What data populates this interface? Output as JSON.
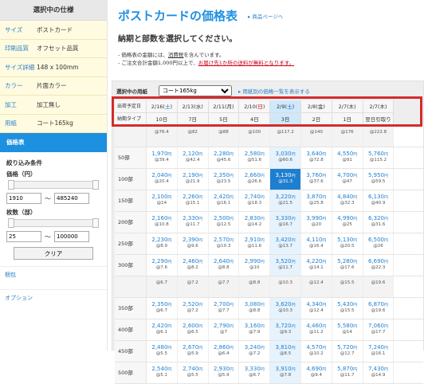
{
  "sidebar": {
    "title": "選択中の仕様",
    "specs": [
      {
        "k": "サイズ",
        "v": "ポストカード"
      },
      {
        "k": "印刷品質",
        "v": "オフセット品質"
      },
      {
        "k": "サイズ詳細",
        "v": "148 x 100mm"
      },
      {
        "k": "カラー",
        "v": "片面カラー"
      },
      {
        "k": "加工",
        "v": "加工無し"
      },
      {
        "k": "用紙",
        "v": "コート165kg"
      }
    ],
    "price_tab": "価格表",
    "filter_title": "絞り込み条件",
    "price_label": "価格（円）",
    "price_min": "1910",
    "price_max": "485240",
    "qty_label": "枚数（部）",
    "qty_min": "25",
    "qty_max": "100000",
    "range_sep": "〜",
    "clear": "クリア",
    "link1": "梱包",
    "link2": "オプション"
  },
  "main": {
    "title": "ポストカードの価格表",
    "title_link": "▸ 商品ページへ",
    "subtitle": "納期と部数を選択してください。",
    "note1_a": "- 価格表の金額には、",
    "note1_b": "消費税",
    "note1_c": "を含んでいます。",
    "note2_a": "- ご注文合計金額1,000円以上で、",
    "note2_b": "お届け先1か所の送料が無料となります。",
    "paper_label": "選択中の用紙",
    "paper_value": "コート165kg",
    "paper_link": "▸ 用紙別の価格一覧を表示する",
    "ship_label": "出荷予定日",
    "type_label": "納期タイプ"
  },
  "dates": [
    {
      "d": "2/16",
      "w": "土",
      "cls": "sat"
    },
    {
      "d": "2/13",
      "w": "水",
      "cls": ""
    },
    {
      "d": "2/11",
      "w": "月",
      "cls": ""
    },
    {
      "d": "2/10",
      "w": "日",
      "cls": "sun"
    },
    {
      "d": "2/9",
      "w": "土",
      "cls": "sat"
    },
    {
      "d": "2/8",
      "w": "金",
      "cls": ""
    },
    {
      "d": "2/7",
      "w": "木",
      "cls": ""
    },
    {
      "d": "2/7",
      "w": "木",
      "cls": ""
    }
  ],
  "types": [
    "10日",
    "7日",
    "5日",
    "4日",
    "3日",
    "2日",
    "1日",
    "翌日引取り"
  ],
  "rows": [
    {
      "q": "",
      "grey": true,
      "cells": [
        [
          "",
          "@76.4"
        ],
        [
          "",
          "@82"
        ],
        [
          "",
          "@88"
        ],
        [
          "",
          "@100"
        ],
        [
          "",
          "@117.2"
        ],
        [
          "",
          "@140"
        ],
        [
          "",
          "@176"
        ],
        [
          "",
          "@222.8"
        ]
      ]
    },
    {
      "q": "50部",
      "cells": [
        [
          "1,970",
          "@39.4"
        ],
        [
          "2,120",
          "@42.4"
        ],
        [
          "2,280",
          "@45.6"
        ],
        [
          "2,580",
          "@51.6"
        ],
        [
          "3,030",
          "@60.6"
        ],
        [
          "3,640",
          "@72.8"
        ],
        [
          "4,550",
          "@91"
        ],
        [
          "5,760",
          "@115.2"
        ]
      ]
    },
    {
      "q": "100部",
      "cells": [
        [
          "2,040",
          "@20.4"
        ],
        [
          "2,190",
          "@21.9"
        ],
        [
          "2,350",
          "@23.5"
        ],
        [
          "2,660",
          "@26.6"
        ],
        [
          "3,130",
          "@31.3"
        ],
        [
          "3,760",
          "@37.6"
        ],
        [
          "4,700",
          "@47"
        ],
        [
          "5,950",
          "@59.5"
        ]
      ]
    },
    {
      "q": "150部",
      "cells": [
        [
          "2,100",
          "@14"
        ],
        [
          "2,260",
          "@15.1"
        ],
        [
          "2,420",
          "@16.1"
        ],
        [
          "2,740",
          "@18.3"
        ],
        [
          "3,220",
          "@21.5"
        ],
        [
          "3,870",
          "@25.8"
        ],
        [
          "4,840",
          "@32.3"
        ],
        [
          "6,130",
          "@40.9"
        ]
      ]
    },
    {
      "q": "200部",
      "cells": [
        [
          "2,160",
          "@10.8"
        ],
        [
          "2,330",
          "@11.7"
        ],
        [
          "2,500",
          "@12.5"
        ],
        [
          "2,830",
          "@14.2"
        ],
        [
          "3,330",
          "@16.7"
        ],
        [
          "3,990",
          "@20"
        ],
        [
          "4,990",
          "@25"
        ],
        [
          "6,320",
          "@31.6"
        ]
      ]
    },
    {
      "q": "250部",
      "cells": [
        [
          "2,230",
          "@8.9"
        ],
        [
          "2,390",
          "@9.6"
        ],
        [
          "2,570",
          "@10.3"
        ],
        [
          "2,910",
          "@11.6"
        ],
        [
          "3,420",
          "@13.7"
        ],
        [
          "4,110",
          "@16.4"
        ],
        [
          "5,130",
          "@20.5"
        ],
        [
          "6,500",
          "@26"
        ]
      ]
    },
    {
      "q": "300部",
      "cells": [
        [
          "2,290",
          "@7.6"
        ],
        [
          "2,460",
          "@8.2"
        ],
        [
          "2,640",
          "@8.8"
        ],
        [
          "2,990",
          "@10"
        ],
        [
          "3,520",
          "@11.7"
        ],
        [
          "4,220",
          "@14.1"
        ],
        [
          "5,280",
          "@17.6"
        ],
        [
          "6,690",
          "@22.3"
        ]
      ]
    },
    {
      "q": "",
      "grey": true,
      "cells": [
        [
          "",
          "@6.7"
        ],
        [
          "",
          "@7.2"
        ],
        [
          "",
          "@7.7"
        ],
        [
          "",
          "@8.8"
        ],
        [
          "",
          "@10.3"
        ],
        [
          "",
          "@12.4"
        ],
        [
          "",
          "@15.5"
        ],
        [
          "",
          "@19.6"
        ]
      ]
    },
    {
      "q": "350部",
      "cells": [
        [
          "2,350",
          "@6.7"
        ],
        [
          "2,520",
          "@7.2"
        ],
        [
          "2,700",
          "@7.7"
        ],
        [
          "3,080",
          "@8.8"
        ],
        [
          "3,620",
          "@10.3"
        ],
        [
          "4,340",
          "@12.4"
        ],
        [
          "5,430",
          "@15.5"
        ],
        [
          "6,870",
          "@19.6"
        ]
      ]
    },
    {
      "q": "400部",
      "cells": [
        [
          "2,420",
          "@6.1"
        ],
        [
          "2,600",
          "@6.5"
        ],
        [
          "2,790",
          "@7"
        ],
        [
          "3,160",
          "@7.9"
        ],
        [
          "3,720",
          "@9.3"
        ],
        [
          "4,460",
          "@11.2"
        ],
        [
          "5,580",
          "@14"
        ],
        [
          "7,060",
          "@17.7"
        ]
      ]
    },
    {
      "q": "450部",
      "cells": [
        [
          "2,480",
          "@5.5"
        ],
        [
          "2,670",
          "@5.9"
        ],
        [
          "2,860",
          "@6.4"
        ],
        [
          "3,240",
          "@7.2"
        ],
        [
          "3,810",
          "@8.5"
        ],
        [
          "4,570",
          "@10.2"
        ],
        [
          "5,720",
          "@12.7"
        ],
        [
          "7,240",
          "@16.1"
        ]
      ]
    },
    {
      "q": "500部",
      "cells": [
        [
          "2,540",
          "@5.1"
        ],
        [
          "2,740",
          "@5.5"
        ],
        [
          "2,930",
          "@5.9"
        ],
        [
          "3,330",
          "@6.7"
        ],
        [
          "3,910",
          "@7.8"
        ],
        [
          "4,690",
          "@9.4"
        ],
        [
          "5,870",
          "@11.7"
        ],
        [
          "7,430",
          "@14.9"
        ]
      ]
    }
  ],
  "price_unit": "円",
  "colors": {
    "accent": "#1e90e0",
    "frame": "#d62b2b",
    "sidebar_bg": "#fffbe0"
  }
}
